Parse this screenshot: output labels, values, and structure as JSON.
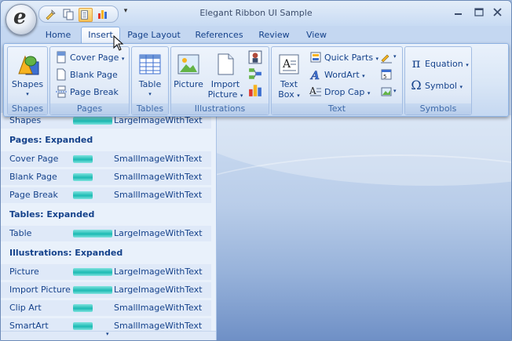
{
  "window": {
    "title": "Elegant Ribbon UI Sample",
    "app_logo_letter": "e"
  },
  "qat": {
    "more_glyph": "▾"
  },
  "tabs": [
    {
      "label": "Home",
      "active": false
    },
    {
      "label": "Insert",
      "active": true
    },
    {
      "label": "Page Layout",
      "active": false
    },
    {
      "label": "References",
      "active": false
    },
    {
      "label": "Review",
      "active": false
    },
    {
      "label": "View",
      "active": false
    }
  ],
  "ribbon": {
    "shapes_group": {
      "label": "Shapes",
      "shapes_button": "Shapes"
    },
    "pages_group": {
      "label": "Pages",
      "cover_page": "Cover Page",
      "blank_page": "Blank Page",
      "page_break": "Page Break"
    },
    "tables_group": {
      "label": "Tables",
      "table_button": "Table"
    },
    "illustrations_group": {
      "label": "Illustrations",
      "picture": "Picture",
      "import_picture_line1": "Import",
      "import_picture_line2": "Picture"
    },
    "text_group": {
      "label": "Text",
      "text_box_line1": "Text",
      "text_box_line2": "Box",
      "quick_parts": "Quick Parts",
      "wordart": "WordArt",
      "drop_cap": "Drop Cap"
    },
    "symbols_group": {
      "label": "Symbols",
      "equation": "Equation",
      "symbol": "Symbol"
    }
  },
  "list": {
    "rows": [
      {
        "type": "item",
        "name": "Shapes",
        "size": "LargeImageWithText",
        "bar": "large"
      },
      {
        "type": "section",
        "name": "Pages: Expanded"
      },
      {
        "type": "item",
        "name": "Cover Page",
        "size": "SmallImageWithText",
        "bar": "small"
      },
      {
        "type": "item",
        "name": "Blank Page",
        "size": "SmallImageWithText",
        "bar": "small"
      },
      {
        "type": "item",
        "name": "Page Break",
        "size": "SmallImageWithText",
        "bar": "small"
      },
      {
        "type": "section",
        "name": "Tables: Expanded"
      },
      {
        "type": "item",
        "name": "Table",
        "size": "LargeImageWithText",
        "bar": "large"
      },
      {
        "type": "section",
        "name": "Illustrations: Expanded"
      },
      {
        "type": "item",
        "name": "Picture",
        "size": "LargeImageWithText",
        "bar": "large"
      },
      {
        "type": "item",
        "name": "Import Picture",
        "size": "LargeImageWithText",
        "bar": "large"
      },
      {
        "type": "item",
        "name": "Clip Art",
        "size": "SmallImageWithText",
        "bar": "small"
      },
      {
        "type": "item",
        "name": "SmartArt",
        "size": "SmallImageWithText",
        "bar": "small"
      }
    ]
  },
  "colors": {
    "accent": "#15428b",
    "progress": "#1cbab3",
    "ribbon_bg": "#dfe9f7"
  }
}
